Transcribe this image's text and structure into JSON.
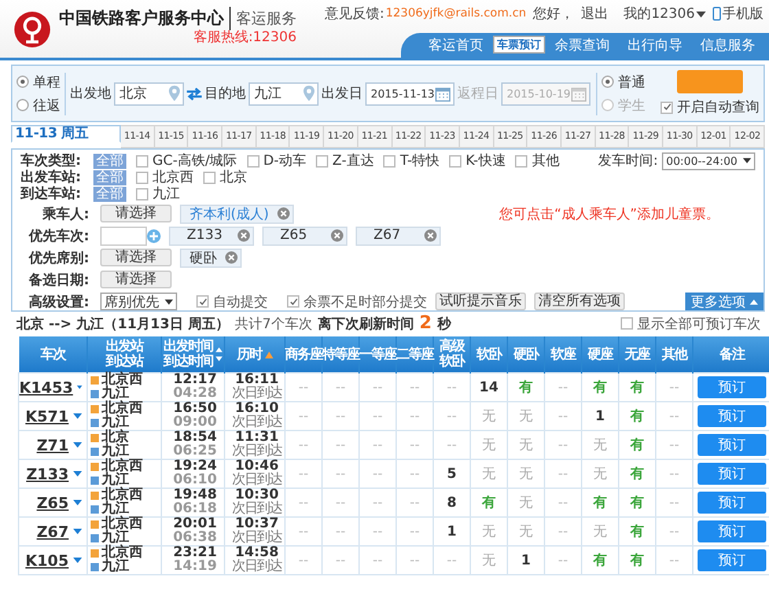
{
  "header": {
    "site_title": "中国铁路客户服务中心",
    "section": "客运服务",
    "hotline": "客服热线:12306",
    "feedback_label": "意见反馈:",
    "feedback_email": "12306yjfk@rails.com.cn",
    "greeting": "您好，",
    "logout": "退出",
    "account": "我的12306",
    "mobile": "手机版",
    "nav": [
      {
        "label": "客运首页",
        "selected": false
      },
      {
        "label": "车票预订",
        "selected": true
      },
      {
        "label": "余票查询",
        "selected": false
      },
      {
        "label": "出行向导",
        "selected": false
      },
      {
        "label": "信息服务",
        "selected": false
      }
    ]
  },
  "search": {
    "trip_types": [
      {
        "label": "单程",
        "selected": true
      },
      {
        "label": "往返",
        "selected": false
      }
    ],
    "from": {
      "label": "出发地",
      "value": "北京"
    },
    "to": {
      "label": "目的地",
      "value": "九江"
    },
    "depart": {
      "label": "出发日",
      "value": "2015-11-13",
      "disabled": false
    },
    "return": {
      "label": "返程日",
      "value": "2015-10-19",
      "disabled": true
    },
    "ticket_types": [
      {
        "label": "普通",
        "selected": true
      },
      {
        "label": "学生",
        "selected": false
      }
    ],
    "auto_query": {
      "label": "开启自动查询",
      "checked": true
    }
  },
  "dates": [
    {
      "label": "11-13 周五",
      "selected": true
    },
    {
      "label": "11-14",
      "selected": false
    },
    {
      "label": "11-15",
      "selected": false
    },
    {
      "label": "11-16",
      "selected": false
    },
    {
      "label": "11-17",
      "selected": false
    },
    {
      "label": "11-18",
      "selected": false
    },
    {
      "label": "11-19",
      "selected": false
    },
    {
      "label": "11-20",
      "selected": false
    },
    {
      "label": "11-21",
      "selected": false
    },
    {
      "label": "11-22",
      "selected": false
    },
    {
      "label": "11-23",
      "selected": false
    },
    {
      "label": "11-24",
      "selected": false
    },
    {
      "label": "11-25",
      "selected": false
    },
    {
      "label": "11-26",
      "selected": false
    },
    {
      "label": "11-27",
      "selected": false
    },
    {
      "label": "11-28",
      "selected": false
    },
    {
      "label": "11-29",
      "selected": false
    },
    {
      "label": "11-30",
      "selected": false
    },
    {
      "label": "12-01",
      "selected": false
    },
    {
      "label": "12-02",
      "selected": false
    }
  ],
  "filters": {
    "train_types": {
      "label": "车次类型:",
      "all": "全部",
      "options": [
        {
          "label": "GC-高铁/城际",
          "checked": false
        },
        {
          "label": "D-动车",
          "checked": false
        },
        {
          "label": "Z-直达",
          "checked": false
        },
        {
          "label": "T-特快",
          "checked": false
        },
        {
          "label": "K-快速",
          "checked": false
        },
        {
          "label": "其他",
          "checked": false
        }
      ]
    },
    "depart_time": {
      "label": "发车时间:",
      "value": "00:00--24:00"
    },
    "depart_stations": {
      "label": "出发车站:",
      "all": "全部",
      "options": [
        {
          "label": "北京西",
          "checked": false
        },
        {
          "label": "北京",
          "checked": false
        }
      ]
    },
    "arrive_stations": {
      "label": "到达车站:",
      "all": "全部",
      "options": [
        {
          "label": "九江",
          "checked": false
        }
      ]
    },
    "passenger": {
      "label": "乘车人:",
      "button": "请选择",
      "tags": [
        "齐本利(成人)"
      ],
      "hint": "您可点击“成人乘车人”添加儿童票。"
    },
    "preferred_trains": {
      "label": "优先车次:",
      "tags": [
        "Z133",
        "Z65",
        "Z67"
      ]
    },
    "preferred_seats": {
      "label": "优先席别:",
      "button": "请选择",
      "tags": [
        "硬卧"
      ]
    },
    "alt_dates": {
      "label": "备选日期:",
      "button": "请选择"
    },
    "advanced": {
      "label": "高级设置:",
      "select": "席别优先",
      "checks": [
        {
          "label": "自动提交",
          "checked": true
        },
        {
          "label": "余票不足时部分提交",
          "checked": true
        }
      ],
      "buttons": [
        "试听提示音乐",
        "清空所有选项"
      ]
    },
    "more": "更多选项"
  },
  "results": {
    "route": "北京 --> 九江（11月13日  周五）",
    "count": "共计7个车次",
    "refresh_label": "离下次刷新时间",
    "refresh_seconds": "2",
    "refresh_unit": "秒",
    "show_all": {
      "label": "显示全部可预订车次",
      "checked": false
    }
  },
  "table": {
    "columns": [
      {
        "lines": [
          "车次"
        ],
        "kind": "plain"
      },
      {
        "lines": [
          "出发站",
          "到达站"
        ],
        "kind": "plain"
      },
      {
        "lines": [
          "出发时间",
          "到达时间"
        ],
        "kind": "sortable"
      },
      {
        "lines": [
          "历时"
        ],
        "kind": "sorted"
      },
      {
        "lines": [
          "商务座"
        ],
        "kind": "plain"
      },
      {
        "lines": [
          "特等座"
        ],
        "kind": "plain"
      },
      {
        "lines": [
          "一等座"
        ],
        "kind": "plain"
      },
      {
        "lines": [
          "二等座"
        ],
        "kind": "plain"
      },
      {
        "lines": [
          "高级",
          "软卧"
        ],
        "kind": "plain"
      },
      {
        "lines": [
          "软卧"
        ],
        "kind": "plain"
      },
      {
        "lines": [
          "硬卧"
        ],
        "kind": "plain"
      },
      {
        "lines": [
          "软座"
        ],
        "kind": "plain"
      },
      {
        "lines": [
          "硬座"
        ],
        "kind": "plain"
      },
      {
        "lines": [
          "无座"
        ],
        "kind": "plain"
      },
      {
        "lines": [
          "其他"
        ],
        "kind": "plain"
      },
      {
        "lines": [
          "备注"
        ],
        "kind": "plain"
      }
    ],
    "rows": [
      {
        "train": "K1453",
        "from": "北京西",
        "to": "九江",
        "depart": "12:17",
        "arrive": "04:28",
        "duration": "16:11",
        "note": "次日到达",
        "seats": [
          {
            "text": "--",
            "kind": "none"
          },
          {
            "text": "--",
            "kind": "none"
          },
          {
            "text": "--",
            "kind": "none"
          },
          {
            "text": "--",
            "kind": "none"
          },
          {
            "text": "--",
            "kind": "none"
          },
          {
            "text": "14",
            "kind": "count"
          },
          {
            "text": "有",
            "kind": "yes"
          },
          {
            "text": "--",
            "kind": "none"
          },
          {
            "text": "有",
            "kind": "yes"
          },
          {
            "text": "有",
            "kind": "yes"
          },
          {
            "text": "--",
            "kind": "none"
          }
        ],
        "button": "预订"
      },
      {
        "train": "K571",
        "from": "北京西",
        "to": "九江",
        "depart": "16:50",
        "arrive": "09:00",
        "duration": "16:10",
        "note": "次日到达",
        "seats": [
          {
            "text": "--",
            "kind": "none"
          },
          {
            "text": "--",
            "kind": "none"
          },
          {
            "text": "--",
            "kind": "none"
          },
          {
            "text": "--",
            "kind": "none"
          },
          {
            "text": "--",
            "kind": "none"
          },
          {
            "text": "无",
            "kind": "no"
          },
          {
            "text": "无",
            "kind": "no"
          },
          {
            "text": "--",
            "kind": "none"
          },
          {
            "text": "1",
            "kind": "count"
          },
          {
            "text": "有",
            "kind": "yes"
          },
          {
            "text": "--",
            "kind": "none"
          }
        ],
        "button": "预订"
      },
      {
        "train": "Z71",
        "from": "北京",
        "to": "九江",
        "depart": "18:54",
        "arrive": "06:25",
        "duration": "11:31",
        "note": "次日到达",
        "seats": [
          {
            "text": "--",
            "kind": "none"
          },
          {
            "text": "--",
            "kind": "none"
          },
          {
            "text": "--",
            "kind": "none"
          },
          {
            "text": "--",
            "kind": "none"
          },
          {
            "text": "--",
            "kind": "none"
          },
          {
            "text": "无",
            "kind": "no"
          },
          {
            "text": "无",
            "kind": "no"
          },
          {
            "text": "--",
            "kind": "none"
          },
          {
            "text": "无",
            "kind": "no"
          },
          {
            "text": "有",
            "kind": "yes"
          },
          {
            "text": "--",
            "kind": "none"
          }
        ],
        "button": "预订"
      },
      {
        "train": "Z133",
        "from": "北京西",
        "to": "九江",
        "depart": "19:24",
        "arrive": "06:10",
        "duration": "10:46",
        "note": "次日到达",
        "seats": [
          {
            "text": "--",
            "kind": "none"
          },
          {
            "text": "--",
            "kind": "none"
          },
          {
            "text": "--",
            "kind": "none"
          },
          {
            "text": "--",
            "kind": "none"
          },
          {
            "text": "5",
            "kind": "count"
          },
          {
            "text": "无",
            "kind": "no"
          },
          {
            "text": "无",
            "kind": "no"
          },
          {
            "text": "--",
            "kind": "none"
          },
          {
            "text": "无",
            "kind": "no"
          },
          {
            "text": "有",
            "kind": "yes"
          },
          {
            "text": "--",
            "kind": "none"
          }
        ],
        "button": "预订"
      },
      {
        "train": "Z65",
        "from": "北京西",
        "to": "九江",
        "depart": "19:48",
        "arrive": "06:18",
        "duration": "10:30",
        "note": "次日到达",
        "seats": [
          {
            "text": "--",
            "kind": "none"
          },
          {
            "text": "--",
            "kind": "none"
          },
          {
            "text": "--",
            "kind": "none"
          },
          {
            "text": "--",
            "kind": "none"
          },
          {
            "text": "8",
            "kind": "count"
          },
          {
            "text": "有",
            "kind": "yes"
          },
          {
            "text": "无",
            "kind": "no"
          },
          {
            "text": "--",
            "kind": "none"
          },
          {
            "text": "有",
            "kind": "yes"
          },
          {
            "text": "有",
            "kind": "yes"
          },
          {
            "text": "--",
            "kind": "none"
          }
        ],
        "button": "预订"
      },
      {
        "train": "Z67",
        "from": "北京西",
        "to": "九江",
        "depart": "20:01",
        "arrive": "06:38",
        "duration": "10:37",
        "note": "次日到达",
        "seats": [
          {
            "text": "--",
            "kind": "none"
          },
          {
            "text": "--",
            "kind": "none"
          },
          {
            "text": "--",
            "kind": "none"
          },
          {
            "text": "--",
            "kind": "none"
          },
          {
            "text": "1",
            "kind": "count"
          },
          {
            "text": "无",
            "kind": "no"
          },
          {
            "text": "无",
            "kind": "no"
          },
          {
            "text": "--",
            "kind": "none"
          },
          {
            "text": "无",
            "kind": "no"
          },
          {
            "text": "有",
            "kind": "yes"
          },
          {
            "text": "--",
            "kind": "none"
          }
        ],
        "button": "预订"
      },
      {
        "train": "K105",
        "from": "北京西",
        "to": "九江",
        "depart": "23:21",
        "arrive": "14:19",
        "duration": "14:58",
        "note": "次日到达",
        "seats": [
          {
            "text": "--",
            "kind": "none"
          },
          {
            "text": "--",
            "kind": "none"
          },
          {
            "text": "--",
            "kind": "none"
          },
          {
            "text": "--",
            "kind": "none"
          },
          {
            "text": "--",
            "kind": "none"
          },
          {
            "text": "无",
            "kind": "no"
          },
          {
            "text": "1",
            "kind": "count"
          },
          {
            "text": "--",
            "kind": "none"
          },
          {
            "text": "有",
            "kind": "yes"
          },
          {
            "text": "有",
            "kind": "yes"
          },
          {
            "text": "--",
            "kind": "none"
          }
        ],
        "button": "预订"
      }
    ]
  }
}
